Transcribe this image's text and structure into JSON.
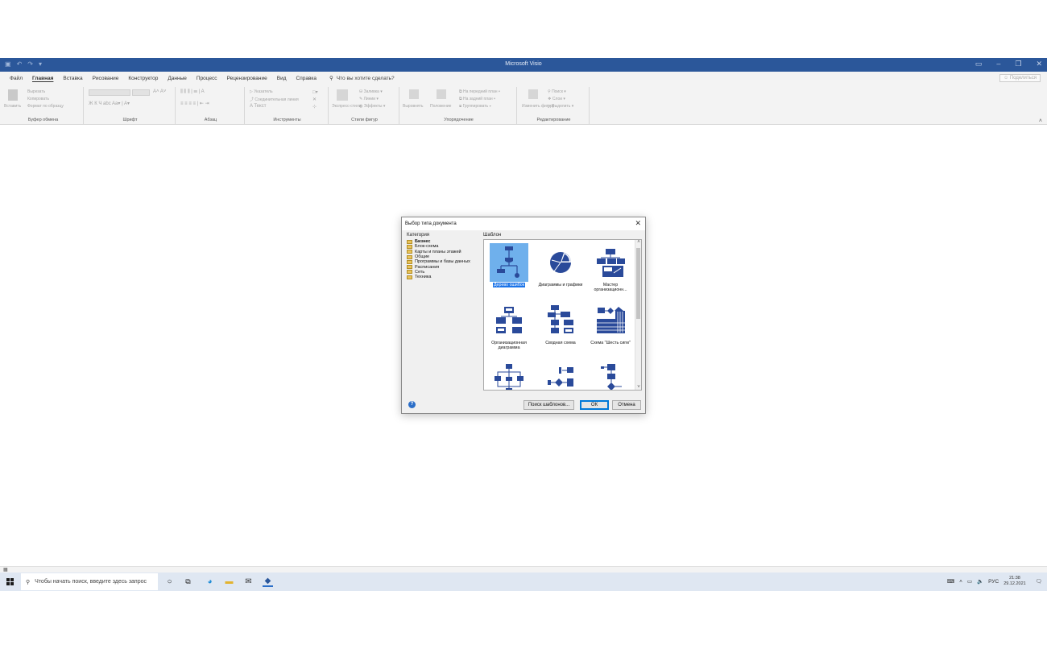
{
  "app": {
    "title": "Microsoft Visio",
    "qat_icons": [
      "save-icon",
      "undo-icon",
      "redo-icon",
      "customize-icon"
    ]
  },
  "menu": {
    "tabs": [
      "Файл",
      "Главная",
      "Вставка",
      "Рисование",
      "Конструктор",
      "Данные",
      "Процесс",
      "Рецензирование",
      "Вид",
      "Справка"
    ],
    "active_tab": "Главная",
    "tell_me": "Что вы хотите сделать?",
    "share": "Поделиться"
  },
  "ribbon": {
    "groups": {
      "clipboard": "Буфер обмена",
      "font": "Шрифт",
      "paragraph": "Абзац",
      "tools": "Инструменты",
      "shape_styles": "Стили фигур",
      "arrange": "Упорядочение",
      "editing": "Редактирование"
    },
    "items": {
      "paste": "Вставить",
      "cut": "Вырезать",
      "copy": "Копировать",
      "format_painter": "Формат по образцу",
      "pointer": "Указатель",
      "connector": "Соединительная линия",
      "text": "Текст",
      "quick_styles": "Экспресс-стили",
      "fill": "Заливка",
      "line": "Линии",
      "effects": "Эффекты",
      "align": "Выровнять",
      "position": "Положение",
      "bring_front": "На передний план",
      "send_back": "На задний план",
      "group": "Группировать",
      "change_shape": "Изменить фигуру",
      "find": "Поиск",
      "layers": "Слои",
      "select": "Выделить"
    }
  },
  "dialog": {
    "title": "Выбор типа документа",
    "category_label": "Категория",
    "template_label": "Шаблон",
    "categories": [
      "Бизнес",
      "Блок-схема",
      "Карты и планы этажей",
      "Общие",
      "Программы и базы данных",
      "Расписания",
      "Сеть",
      "Техника"
    ],
    "selected_category": "Бизнес",
    "templates": [
      "Дерево ошибок",
      "Диаграммы и графики",
      "Мастер организационн...",
      "Организационная диаграмма",
      "Сводная схема",
      "Схема \"Шесть сигм\""
    ],
    "selected_template": "Дерево ошибок",
    "buttons": {
      "search": "Поиск шаблонов...",
      "ok": "ОК",
      "cancel": "Отмена"
    }
  },
  "taskbar": {
    "search_placeholder": "Чтобы начать поиск, введите здесь запрос",
    "lang": "РУС",
    "time": "21:38",
    "date": "29.12.2021"
  },
  "colors": {
    "titlebar": "#2b579a",
    "icon_blue": "#2a4a9a",
    "selection": "#6fb0ec"
  }
}
